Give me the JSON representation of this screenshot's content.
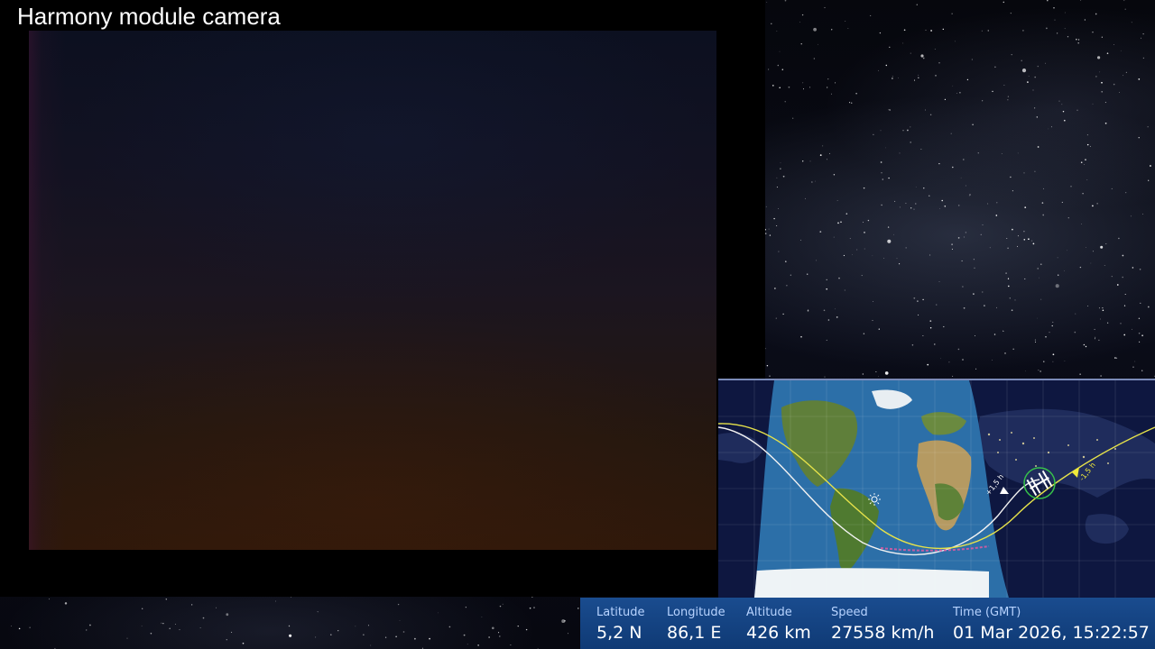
{
  "camera": {
    "title": "Harmony module camera"
  },
  "map": {
    "track_label_ahead": "+1,5 h",
    "track_label_behind": "-1,5 h",
    "colors": {
      "ocean": "#2c6fa8",
      "night_side": "#0e1740",
      "track_future": "#f2f2f2",
      "track_past": "#e6e24a",
      "station_ring": "#37c24a"
    }
  },
  "telemetry": {
    "latitude": {
      "label": "Latitude",
      "value": "5,2 N"
    },
    "longitude": {
      "label": "Longitude",
      "value": "86,1 E"
    },
    "altitude": {
      "label": "Altitude",
      "value": "426 km"
    },
    "speed": {
      "label": "Speed",
      "value": "27558 km/h"
    },
    "time": {
      "label": "Time (GMT)",
      "value": "01 Mar 2026, 15:22:57"
    }
  }
}
